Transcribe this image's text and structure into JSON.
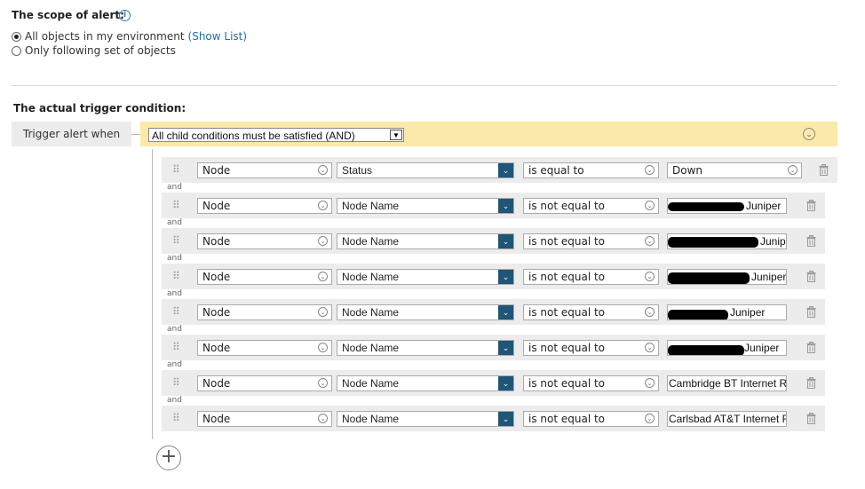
{
  "scope": {
    "title": "The scope of alert:",
    "options": [
      {
        "label": "All objects in my environment",
        "link": "(Show List)",
        "selected": true
      },
      {
        "label": "Only following set of objects",
        "selected": false
      }
    ]
  },
  "trigger": {
    "title": "The actual trigger condition:",
    "label": "Trigger alert when",
    "group_operator": "All child conditions must be satisfied (AND)",
    "join_word": "and",
    "conditions": [
      {
        "object": "Node",
        "field": "Status",
        "operator": "is equal to",
        "value": "Down"
      },
      {
        "object": "Node",
        "field": "Node Name",
        "operator": "is not equal to",
        "value": "Juniper",
        "redacted": true
      },
      {
        "object": "Node",
        "field": "Node Name",
        "operator": "is not equal to",
        "value": "Junip",
        "redacted": true
      },
      {
        "object": "Node",
        "field": "Node Name",
        "operator": "is not equal to",
        "value": "Juniper",
        "redacted": true
      },
      {
        "object": "Node",
        "field": "Node Name",
        "operator": "is not equal to",
        "value": "Juniper",
        "redacted": true
      },
      {
        "object": "Node",
        "field": "Node Name",
        "operator": "is not equal to",
        "value": "Juniper",
        "redacted": true
      },
      {
        "object": "Node",
        "field": "Node Name",
        "operator": "is not equal to",
        "value": "Cambridge BT Internet R"
      },
      {
        "object": "Node",
        "field": "Node Name",
        "operator": "is not equal to",
        "value": "Carlsbad AT&T Internet F"
      }
    ]
  },
  "colors": {
    "accent": "#1f5577",
    "group_bar": "#fbe9a9",
    "link": "#1e6fa8"
  },
  "icons": {
    "info": "info-icon",
    "collapse": "chevron-down-circle-icon",
    "drag": "drag-handle-icon",
    "delete": "trash-icon",
    "add": "add-circle-icon"
  }
}
